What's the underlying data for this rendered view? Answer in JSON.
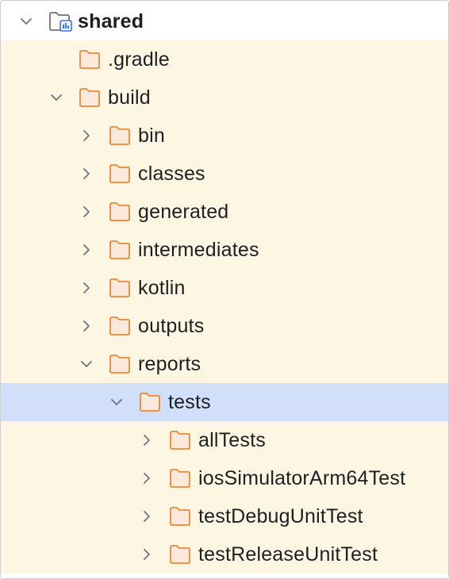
{
  "theme": {
    "folder_stroke": "#e8893b",
    "folder_fill": "#fde9d9",
    "chevron": "#6f737a",
    "module_stroke": "#6f737a",
    "module_badge": "#3574f0",
    "selection": "#d1dffa",
    "row_bg": "#fdf6e3"
  },
  "tree": {
    "root": {
      "label": "shared",
      "icon": "module-folder-icon",
      "expanded": true
    },
    "items": [
      {
        "label": ".gradle",
        "depth": 1,
        "expandable": false,
        "expanded": false,
        "icon": "folder-icon"
      },
      {
        "label": "build",
        "depth": 1,
        "expandable": true,
        "expanded": true,
        "icon": "folder-icon"
      },
      {
        "label": "bin",
        "depth": 2,
        "expandable": true,
        "expanded": false,
        "icon": "folder-icon"
      },
      {
        "label": "classes",
        "depth": 2,
        "expandable": true,
        "expanded": false,
        "icon": "folder-icon"
      },
      {
        "label": "generated",
        "depth": 2,
        "expandable": true,
        "expanded": false,
        "icon": "folder-icon"
      },
      {
        "label": "intermediates",
        "depth": 2,
        "expandable": true,
        "expanded": false,
        "icon": "folder-icon"
      },
      {
        "label": "kotlin",
        "depth": 2,
        "expandable": true,
        "expanded": false,
        "icon": "folder-icon"
      },
      {
        "label": "outputs",
        "depth": 2,
        "expandable": true,
        "expanded": false,
        "icon": "folder-icon"
      },
      {
        "label": "reports",
        "depth": 2,
        "expandable": true,
        "expanded": true,
        "icon": "folder-icon"
      },
      {
        "label": "tests",
        "depth": 3,
        "expandable": true,
        "expanded": true,
        "icon": "folder-icon",
        "selected": true
      },
      {
        "label": "allTests",
        "depth": 4,
        "expandable": true,
        "expanded": false,
        "icon": "folder-icon"
      },
      {
        "label": "iosSimulatorArm64Test",
        "depth": 4,
        "expandable": true,
        "expanded": false,
        "icon": "folder-icon"
      },
      {
        "label": "testDebugUnitTest",
        "depth": 4,
        "expandable": true,
        "expanded": false,
        "icon": "folder-icon"
      },
      {
        "label": "testReleaseUnitTest",
        "depth": 4,
        "expandable": true,
        "expanded": false,
        "icon": "folder-icon"
      }
    ]
  }
}
